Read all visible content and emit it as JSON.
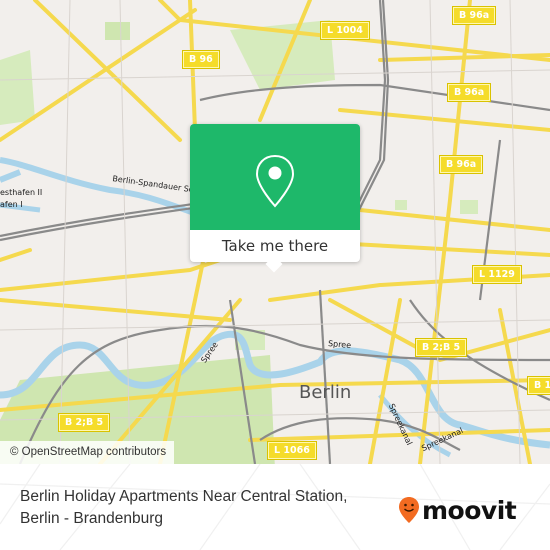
{
  "map": {
    "city_label": "Berlin",
    "attribution": "© OpenStreetMap contributors",
    "road_labels": [
      {
        "id": "l1004",
        "text": "L 1004"
      },
      {
        "id": "b96a-top",
        "text": "B 96a"
      },
      {
        "id": "b96",
        "text": "B 96"
      },
      {
        "id": "b96a-mid",
        "text": "B 96a"
      },
      {
        "id": "b96a-right",
        "text": "B 96a"
      },
      {
        "id": "l1129",
        "text": "L 1129"
      },
      {
        "id": "b2b5-right",
        "text": "B 2;B 5"
      },
      {
        "id": "b1-right",
        "text": "B 1"
      },
      {
        "id": "b2b5-left",
        "text": "B 2;B 5"
      },
      {
        "id": "l1066",
        "text": "L 1066"
      }
    ],
    "water_labels": [
      {
        "id": "berlin-spandauer",
        "text": "Berlin-Spandauer Sch"
      },
      {
        "id": "westhafen-2",
        "text": "esthafen II"
      },
      {
        "id": "westhafen-1",
        "text": "afen I"
      },
      {
        "id": "spree-1",
        "text": "Spree"
      },
      {
        "id": "spree-2",
        "text": "Spree"
      },
      {
        "id": "spreekanal-1",
        "text": "Spreekanal"
      },
      {
        "id": "spreekanal-2",
        "text": "Spreekanal"
      }
    ]
  },
  "popup": {
    "icon": "map-pin-icon",
    "button_label": "Take me there",
    "accent_color": "#1eb86a"
  },
  "footer": {
    "place_line1": "Berlin Holiday Apartments Near Central Station,",
    "place_line2": "Berlin - Brandenburg",
    "logo_text": "moovit",
    "logo_color": "#f26b21"
  }
}
